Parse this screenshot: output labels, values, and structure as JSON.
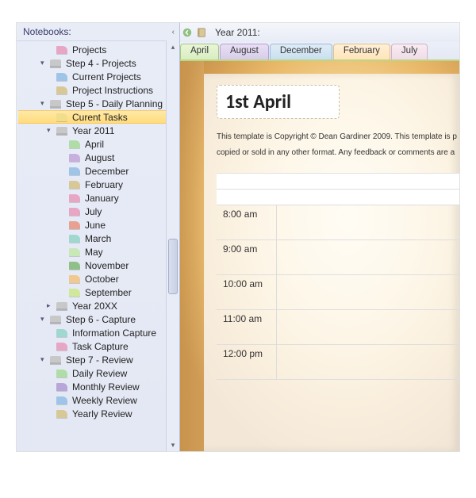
{
  "sidebar": {
    "header": "Notebooks:",
    "items": [
      {
        "level": 2,
        "icon": "c-pink",
        "label": "Projects",
        "expandable": false
      },
      {
        "level": 1,
        "icon": "c-gray",
        "label": "Step 4 - Projects",
        "expandable": true
      },
      {
        "level": 2,
        "icon": "c-blue",
        "label": "Current Projects",
        "expandable": false
      },
      {
        "level": 2,
        "icon": "c-tan",
        "label": "Project Instructions",
        "expandable": false
      },
      {
        "level": 1,
        "icon": "c-gray",
        "label": "Step 5 - Daily Planning",
        "expandable": true
      },
      {
        "level": 2,
        "icon": "c-yellow",
        "label": "Curent Tasks",
        "expandable": false,
        "selected": true
      },
      {
        "level": 2,
        "icon": "c-gray",
        "label": "Year 2011",
        "expandable": true
      },
      {
        "level": 3,
        "icon": "c-green",
        "label": "April",
        "expandable": false
      },
      {
        "level": 3,
        "icon": "c-dpurple",
        "label": "August",
        "expandable": false
      },
      {
        "level": 3,
        "icon": "c-blue",
        "label": "December",
        "expandable": false
      },
      {
        "level": 3,
        "icon": "c-tan",
        "label": "February",
        "expandable": false
      },
      {
        "level": 3,
        "icon": "c-pink",
        "label": "January",
        "expandable": false
      },
      {
        "level": 3,
        "icon": "c-pink",
        "label": "July",
        "expandable": false
      },
      {
        "level": 3,
        "icon": "c-red",
        "label": "June",
        "expandable": false
      },
      {
        "level": 3,
        "icon": "c-teal",
        "label": "March",
        "expandable": false
      },
      {
        "level": 3,
        "icon": "c-lgreen",
        "label": "May",
        "expandable": false
      },
      {
        "level": 3,
        "icon": "c-dgreen",
        "label": "November",
        "expandable": false
      },
      {
        "level": 3,
        "icon": "c-orange",
        "label": "October",
        "expandable": false
      },
      {
        "level": 3,
        "icon": "c-lime",
        "label": "September",
        "expandable": false
      },
      {
        "level": 2,
        "icon": "c-gray",
        "label": "Year 20XX",
        "expandable": true,
        "collapsed": true
      },
      {
        "level": 1,
        "icon": "c-gray",
        "label": "Step 6 - Capture",
        "expandable": true
      },
      {
        "level": 2,
        "icon": "c-teal",
        "label": "Information Capture",
        "expandable": false
      },
      {
        "level": 2,
        "icon": "c-pink",
        "label": "Task Capture",
        "expandable": false
      },
      {
        "level": 1,
        "icon": "c-gray",
        "label": "Step 7 - Review",
        "expandable": true
      },
      {
        "level": 2,
        "icon": "c-green",
        "label": "Daily Review",
        "expandable": false
      },
      {
        "level": 2,
        "icon": "c-purple",
        "label": "Monthly Review",
        "expandable": false
      },
      {
        "level": 2,
        "icon": "c-blue",
        "label": "Weekly Review",
        "expandable": false
      },
      {
        "level": 2,
        "icon": "c-tan",
        "label": "Yearly Review",
        "expandable": false
      }
    ]
  },
  "breadcrumb": {
    "year": "Year 2011:"
  },
  "tabs": [
    {
      "label": "April",
      "cls": "active"
    },
    {
      "label": "August",
      "cls": "c2"
    },
    {
      "label": "December",
      "cls": "c3"
    },
    {
      "label": "February",
      "cls": "c4"
    },
    {
      "label": "July",
      "cls": "c5"
    }
  ],
  "page": {
    "title": "1st April",
    "copyright1": "This template is Copyright © Dean Gardiner 2009. This template is p",
    "copyright2": "copied or sold in any other format. Any feedback or comments are a",
    "times": [
      "8:00 am",
      "9:00 am",
      "10:00 am",
      "11:00 am",
      "12:00 pm"
    ]
  }
}
